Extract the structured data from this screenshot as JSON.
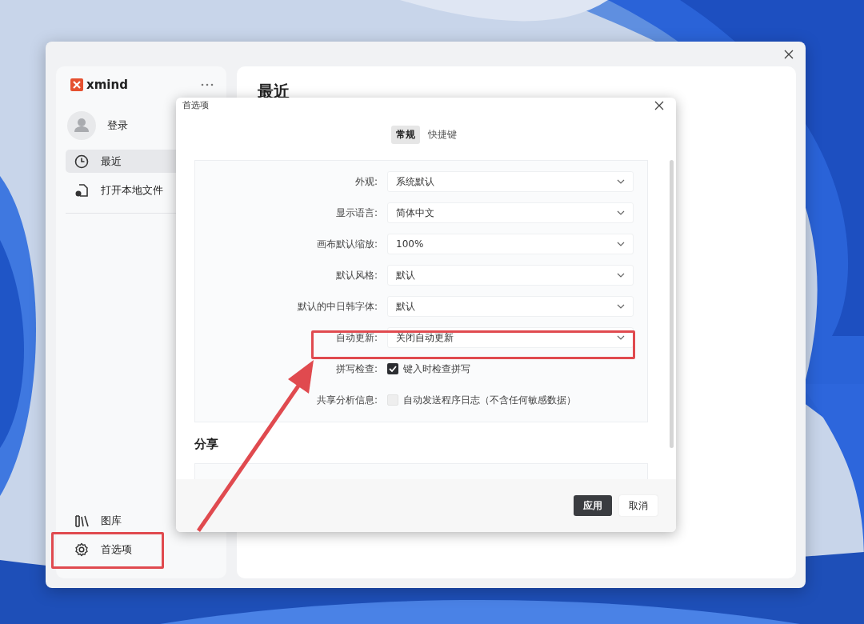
{
  "app": {
    "logo": "xmind",
    "user": "登录",
    "heading": "最近",
    "nav": [
      {
        "label": "最近",
        "selected": true
      },
      {
        "label": "打开本地文件",
        "selected": false
      }
    ],
    "bottom_nav": [
      {
        "label": "图库"
      },
      {
        "label": "首选项"
      }
    ]
  },
  "dialog": {
    "title": "首选项",
    "tabs": [
      {
        "label": "常规",
        "selected": true
      },
      {
        "label": "快捷键",
        "selected": false
      }
    ],
    "settings": [
      {
        "kind": "select",
        "label": "外观:",
        "value": "系统默认"
      },
      {
        "kind": "select",
        "label": "显示语言:",
        "value": "简体中文"
      },
      {
        "kind": "select",
        "label": "画布默认缩放:",
        "value": "100%"
      },
      {
        "kind": "select",
        "label": "默认风格:",
        "value": "默认"
      },
      {
        "kind": "select",
        "label": "默认的中日韩字体:",
        "value": "默认"
      },
      {
        "kind": "select",
        "label": "自动更新:",
        "value": "关闭自动更新"
      },
      {
        "kind": "checkbox",
        "label": "拼写检查:",
        "value": "键入时检查拼写",
        "checked": true
      },
      {
        "kind": "checkbox",
        "label": "共享分析信息:",
        "value": "自动发送程序日志（不含任何敏感数据）",
        "checked": false
      }
    ],
    "section": "分享",
    "buttons": [
      {
        "label": "应用",
        "kind": "primary"
      },
      {
        "label": "取消",
        "kind": "secondary"
      }
    ]
  }
}
